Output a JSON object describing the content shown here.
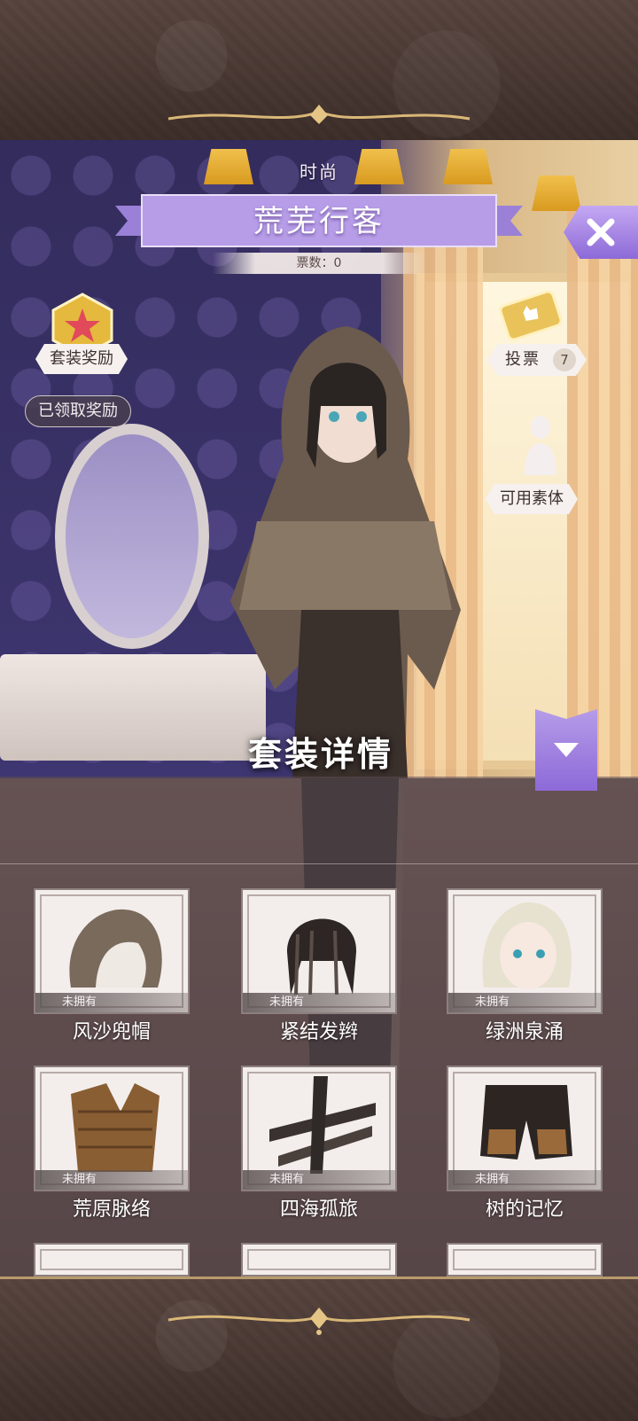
{
  "header": {
    "category": "时尚",
    "title": "荒芜行客",
    "votes_label": "票数：0",
    "close_label": "X"
  },
  "left_panel": {
    "suit_reward_label": "套装奖励",
    "claimed_label": "已领取奖励"
  },
  "right_panel": {
    "vote_label": "投票",
    "vote_count": "7",
    "available_body_label": "可用素体"
  },
  "section": {
    "title": "套装详情"
  },
  "items": [
    {
      "name": "风沙兜帽",
      "status": "未拥有"
    },
    {
      "name": "紧结发辫",
      "status": "未拥有"
    },
    {
      "name": "绿洲泉涌",
      "status": "未拥有"
    },
    {
      "name": "荒原脉络",
      "status": "未拥有"
    },
    {
      "name": "四海孤旅",
      "status": "未拥有"
    },
    {
      "name": "树的记忆",
      "status": "未拥有"
    }
  ],
  "colors": {
    "accent_purple": "#8d6ad8",
    "banner_purple": "#b79de8",
    "gold_trim": "#b89b6d"
  }
}
